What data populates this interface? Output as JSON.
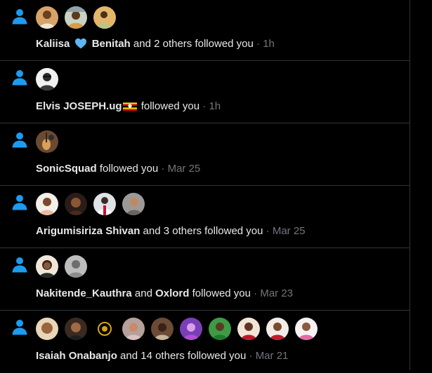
{
  "colors": {
    "accent": "#1d9bf0",
    "background": "#000000",
    "text": "#e7e9ea",
    "muted": "#71767b",
    "divider": "#2f3336"
  },
  "icons": {
    "follow": "person-icon",
    "heart": "blue-heart-icon",
    "flag": "uganda-flag-icon"
  },
  "notifications": [
    {
      "avatar_count": 3,
      "actor1": "Kaliisa",
      "actor2": "Benitah",
      "rest": "and 2 others followed you",
      "sep": " · ",
      "time": "1h"
    },
    {
      "avatar_count": 1,
      "actor1": "Elvis JOSEPH.ug",
      "rest": "followed you",
      "sep": " · ",
      "time": "1h"
    },
    {
      "avatar_count": 1,
      "actor1": "SonicSquad",
      "rest": "followed you",
      "sep": " · ",
      "time": "Mar 25"
    },
    {
      "avatar_count": 4,
      "actor1": "Arigumisiriza Shivan",
      "rest": "and 3 others followed you",
      "sep": " · ",
      "time": "Mar 25"
    },
    {
      "avatar_count": 2,
      "actor1": "Nakitende_Kauthra",
      "connector": "and",
      "actor2": "Oxlord",
      "rest": "followed you",
      "sep": " · ",
      "time": "Mar 23"
    },
    {
      "avatar_count": 10,
      "actor1": "Isaiah Onabanjo",
      "rest": "and 14 others followed you",
      "sep": " · ",
      "time": "Mar 21"
    }
  ]
}
